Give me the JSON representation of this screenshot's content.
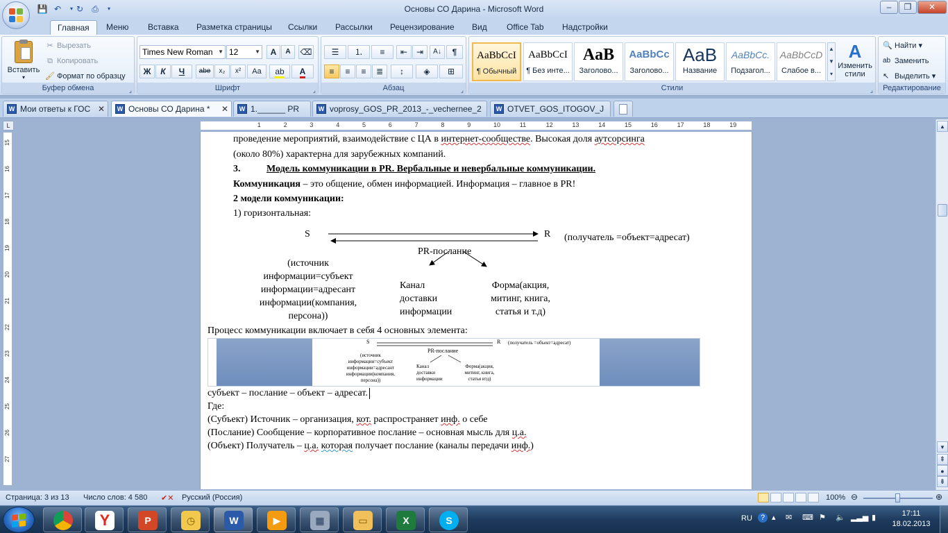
{
  "window": {
    "title": "Основы СО Дарина - Microsoft Word"
  },
  "ribbon_tabs": [
    "Главная",
    "Меню",
    "Вставка",
    "Разметка страницы",
    "Ссылки",
    "Рассылки",
    "Рецензирование",
    "Вид",
    "Office Tab",
    "Надстройки"
  ],
  "clipboard": {
    "paste": "Вставить",
    "cut": "Вырезать",
    "copy": "Копировать",
    "format_painter": "Формат по образцу",
    "caption": "Буфер обмена"
  },
  "font": {
    "name": "Times New Roman",
    "size": "12",
    "caption": "Шрифт",
    "bold": "Ж",
    "italic": "К",
    "underline": "Ч",
    "strike": "abe",
    "subscript": "x₂",
    "superscript": "x²",
    "change_case": "Aa",
    "grow": "A",
    "shrink": "A",
    "color_letter": "A"
  },
  "paragraph": {
    "caption": "Абзац",
    "pilcrow": "¶"
  },
  "styles": {
    "caption": "Стили",
    "items": [
      {
        "sample": "AaBbCcI",
        "name": "¶ Обычный"
      },
      {
        "sample": "AaBbCcI",
        "name": "¶ Без инте..."
      },
      {
        "sample": "AaB",
        "name": "Заголово..."
      },
      {
        "sample": "AaBbCc",
        "name": "Заголово..."
      },
      {
        "sample": "AaB",
        "name": "Название"
      },
      {
        "sample": "AaBbCc.",
        "name": "Подзагол..."
      },
      {
        "sample": "AaBbCcD",
        "name": "Слабое в..."
      }
    ],
    "change_styles_1": "Изменить",
    "change_styles_2": "стили"
  },
  "editing": {
    "caption": "Редактирование",
    "find": "Найти",
    "replace": "Заменить",
    "select": "Выделить"
  },
  "doc_tabs": [
    "Мои ответы к ГОС",
    "Основы СО Дарина *",
    "1.______ PR",
    "voprosy_GOS_PR_2013_-_vechernee_2",
    "OTVET_GOS_ITOGOV_J"
  ],
  "ruler": {
    "h_ticks": [
      "1",
      "2",
      "3",
      "4",
      "5",
      "6",
      "7",
      "8",
      "9",
      "10",
      "11",
      "12",
      "13",
      "14",
      "15",
      "16",
      "17",
      "18",
      "19"
    ],
    "v_ticks": [
      "15",
      "16",
      "17",
      "18",
      "19",
      "20",
      "21",
      "22",
      "23",
      "24",
      "25",
      "26",
      "27"
    ]
  },
  "document": {
    "line1_a": "проведение мероприятий, взаимодействие с ЦА в ",
    "line1_b": "интернет-сообществе",
    "line1_c": ". Высокая доля ",
    "line1_d": "аутсорсинга",
    "line2": "(около 80%) характерна для зарубежных компаний.",
    "heading_num": "3.",
    "heading": "Модель коммуникации в PR. Вербальные и невербальные коммуникации.",
    "def_bold": "Коммуникация",
    "def_rest": " – это общение, обмен информацией. Информация – главное в PR!",
    "models_title": "2 модели коммуникации:",
    "model1": "1) горизонтальная:",
    "diagram": {
      "s": "S",
      "r": "R",
      "receiver": "(получатель =объект=адресат)",
      "message": "PR-послание",
      "source_lines": [
        "(источник",
        "информации=субъект",
        "информации=адресант",
        "информации(компания,",
        "персона))"
      ],
      "channel_lines": [
        "Канал",
        "доставки",
        "информации"
      ],
      "form_lines": [
        "Форма(акция,",
        "митинг, книга,",
        "статья и т.д)"
      ]
    },
    "process": "Процесс коммуникации включает в себя 4 основных элемента:",
    "chain": "субъект – послание – объект – адресат.",
    "where": "Где:",
    "item1_a": "(Субъект) Источник – организация, ",
    "item1_b": "кот.",
    "item1_c": " распространяет ",
    "item1_d": "инф.",
    "item1_e": " о себе",
    "item2_a": "(Послание) Сообщение – корпоративное послание – основная мысль для ",
    "item2_b": "ц.а.",
    "item3_a": "(Объект) Получатель – ",
    "item3_b": "ц.а.",
    "item3_c": " ",
    "item3_d": "которая",
    "item3_e": " получает послание (каналы передачи ",
    "item3_f": "инф.",
    "item3_g": ")",
    "thumb": {
      "receiver": "(получатель =объект=адресат)",
      "form_lines": [
        "Форма(акция,",
        "митинг, книга,",
        "статья итд)"
      ]
    }
  },
  "status": {
    "page": "Страница: 3 из 13",
    "words": "Число слов: 4 580",
    "language": "Русский (Россия)",
    "zoom": "100%"
  },
  "taskbar": {
    "lang": "RU",
    "time": "17:11",
    "date": "18.02.2013"
  },
  "colors": {
    "accent": "#2a5aa8",
    "ribbon_bg": "#dbe6f5",
    "style_active": "#ffe3a3"
  }
}
